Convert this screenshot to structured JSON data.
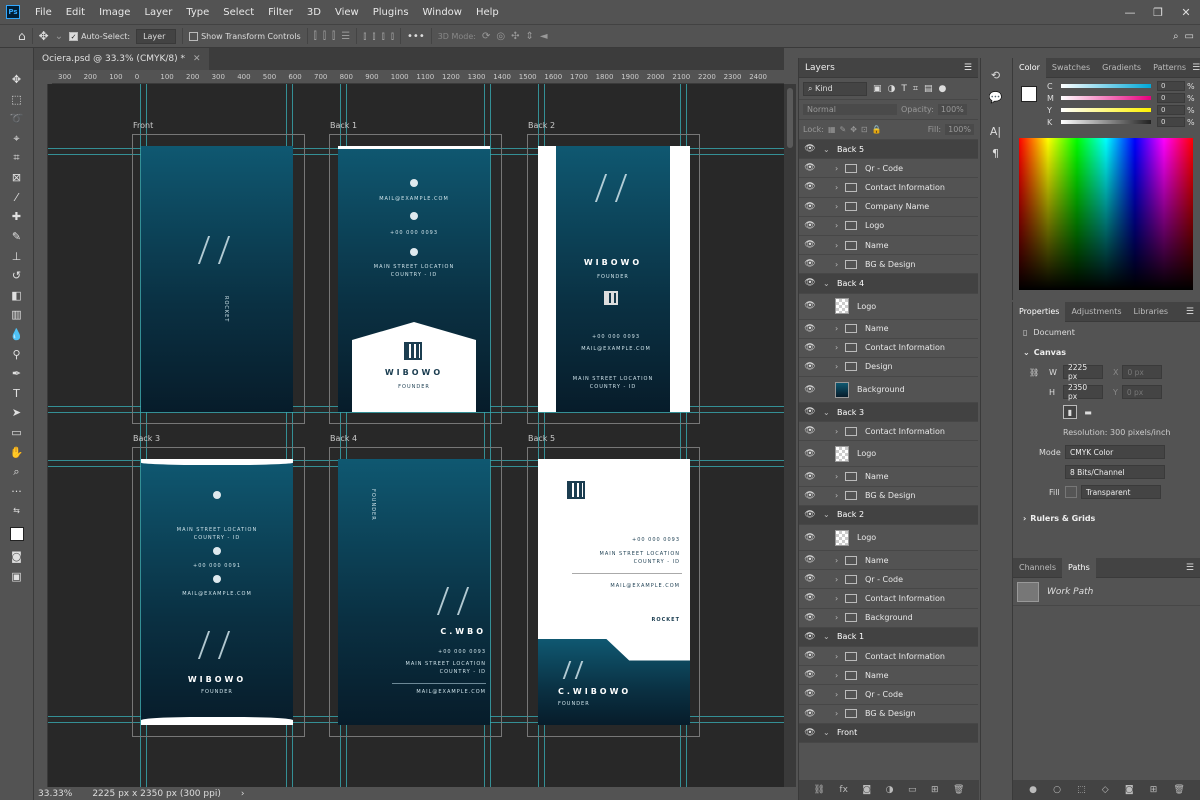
{
  "app": {
    "logo": "Ps"
  },
  "menu": [
    "File",
    "Edit",
    "Image",
    "Layer",
    "Type",
    "Select",
    "Filter",
    "3D",
    "View",
    "Plugins",
    "Window",
    "Help"
  ],
  "options": {
    "auto_select_label": "Auto-Select:",
    "auto_select_value": "Layer",
    "transform_label": "Show Transform Controls",
    "mode3d_label": "3D Mode:"
  },
  "document": {
    "tab_title": "Ociera.psd @ 33.3% (CMYK/8) *",
    "zoom": "33.33%",
    "dims": "2225 px x 2350 px (300 ppi)"
  },
  "ruler_ticks": [
    "300",
    "200",
    "100",
    "0",
    "100",
    "200",
    "300",
    "400",
    "500",
    "600",
    "700",
    "800",
    "900",
    "1000",
    "1100",
    "1200",
    "1300",
    "1400",
    "1500",
    "1600",
    "1700",
    "1800",
    "1900",
    "2000",
    "2100",
    "2200",
    "2300",
    "2400"
  ],
  "canvas": {
    "labels": [
      "Front",
      "Back 1",
      "Back 2",
      "Back 3",
      "Back 4",
      "Back 5"
    ],
    "contact": {
      "mail": "MAIL@EXAMPLE.COM",
      "phone": "+00 000 0093",
      "phone_alt": "+00 000 0091",
      "street": "MAIN STREET LOCATION",
      "country": "COUNTRY - ID"
    },
    "name_short": "WIBOWO",
    "name_initial": "C.WBO",
    "name_full": "C.WIBOWO",
    "role": "FOUNDER",
    "brand": "ROCKET"
  },
  "layers_panel": {
    "title": "Layers",
    "kind": "Kind",
    "blend": "Normal",
    "opacity_label": "Opacity:",
    "opacity": "100%",
    "lock_label": "Lock:",
    "fill_label": "Fill:",
    "fill": "100%",
    "rows": [
      {
        "name": "Back 5",
        "type": "group"
      },
      {
        "name": "Qr - Code",
        "type": "folder"
      },
      {
        "name": "Contact Information",
        "type": "folder"
      },
      {
        "name": "Company Name",
        "type": "folder"
      },
      {
        "name": "Logo",
        "type": "folder"
      },
      {
        "name": "Name",
        "type": "folder"
      },
      {
        "name": "BG & Design",
        "type": "folder"
      },
      {
        "name": "Back 4",
        "type": "group"
      },
      {
        "name": "Logo",
        "type": "thumb"
      },
      {
        "name": "Name",
        "type": "folder"
      },
      {
        "name": "Contact Information",
        "type": "folder"
      },
      {
        "name": "Design",
        "type": "folder"
      },
      {
        "name": "Background",
        "type": "thumbbg"
      },
      {
        "name": "Back 3",
        "type": "group"
      },
      {
        "name": "Contact Information",
        "type": "folder"
      },
      {
        "name": "Logo",
        "type": "thumb"
      },
      {
        "name": "Name",
        "type": "folder"
      },
      {
        "name": "BG & Design",
        "type": "folder"
      },
      {
        "name": "Back 2",
        "type": "group"
      },
      {
        "name": "Logo",
        "type": "thumb"
      },
      {
        "name": "Name",
        "type": "folder"
      },
      {
        "name": "Qr - Code",
        "type": "folder"
      },
      {
        "name": "Contact Information",
        "type": "folder"
      },
      {
        "name": "Background",
        "type": "folder"
      },
      {
        "name": "Back 1",
        "type": "group"
      },
      {
        "name": "Contact Information",
        "type": "folder"
      },
      {
        "name": "Name",
        "type": "folder"
      },
      {
        "name": "Qr - Code",
        "type": "folder"
      },
      {
        "name": "BG & Design",
        "type": "folder"
      },
      {
        "name": "Front",
        "type": "group"
      }
    ]
  },
  "color_panel": {
    "tabs": [
      "Color",
      "Swatches",
      "Gradients",
      "Patterns"
    ],
    "channels": [
      {
        "label": "C",
        "value": "0",
        "color": "#00a8d8"
      },
      {
        "label": "M",
        "value": "0",
        "color": "#e6007e"
      },
      {
        "label": "Y",
        "value": "0",
        "color": "#fff200"
      },
      {
        "label": "K",
        "value": "0",
        "color": "#222222"
      }
    ],
    "pct": "%"
  },
  "properties": {
    "tabs": [
      "Properties",
      "Adjustments",
      "Libraries"
    ],
    "doc_label": "Document",
    "canvas_section": "Canvas",
    "w_label": "W",
    "w": "2225 px",
    "h_label": "H",
    "h": "2350 px",
    "x_label": "X",
    "x": "0 px",
    "y_label": "Y",
    "y": "0 px",
    "resolution": "Resolution: 300 pixels/inch",
    "mode_label": "Mode",
    "mode": "CMYK Color",
    "bits": "8 Bits/Channel",
    "fill_label": "Fill",
    "fill": "Transparent",
    "rulers_section": "Rulers & Grids"
  },
  "channels_panel": {
    "tabs": [
      "Channels",
      "Paths"
    ],
    "work_path": "Work Path"
  }
}
